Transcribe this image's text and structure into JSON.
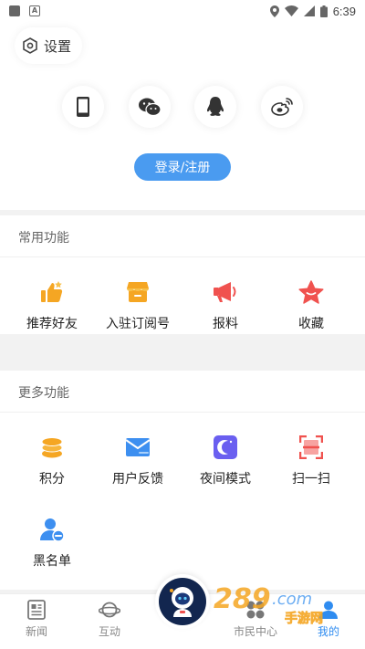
{
  "status_bar": {
    "time": "6:39"
  },
  "header": {
    "settings_label": "设置",
    "login_methods": [
      {
        "icon": "phone-icon"
      },
      {
        "icon": "wechat-icon"
      },
      {
        "icon": "qq-icon"
      },
      {
        "icon": "weibo-icon"
      }
    ],
    "login_button": "登录/注册"
  },
  "common": {
    "title": "常用功能",
    "items": [
      {
        "label": "推荐好友",
        "icon": "thumbs-up-icon",
        "color": "#f5a623"
      },
      {
        "label": "入驻订阅号",
        "icon": "store-icon",
        "color": "#f5a623"
      },
      {
        "label": "报料",
        "icon": "megaphone-icon",
        "color": "#f0524f"
      },
      {
        "label": "收藏",
        "icon": "star-icon",
        "color": "#f0524f"
      }
    ]
  },
  "more": {
    "title": "更多功能",
    "items": [
      {
        "label": "积分",
        "icon": "coins-icon",
        "color": "#f5a623"
      },
      {
        "label": "用户反馈",
        "icon": "mail-icon",
        "color": "#3d8ff0"
      },
      {
        "label": "夜间模式",
        "icon": "moon-icon",
        "color": "#6a5ff0"
      },
      {
        "label": "扫一扫",
        "icon": "scan-icon",
        "color": "#f0524f"
      },
      {
        "label": "黑名单",
        "icon": "block-user-icon",
        "color": "#3d8ff0"
      }
    ]
  },
  "tabbar": {
    "tabs": [
      {
        "label": "新闻",
        "icon": "news-icon"
      },
      {
        "label": "互动",
        "icon": "planet-icon"
      },
      {
        "label": "市民中心",
        "icon": "grid-icon"
      },
      {
        "label": "我的",
        "icon": "user-icon",
        "active": true
      }
    ],
    "center_icon": "astronaut-icon",
    "watermark": "289.com 手游网"
  },
  "colors": {
    "accent": "#4a9bf0",
    "active_tab": "#2f8cf0"
  }
}
